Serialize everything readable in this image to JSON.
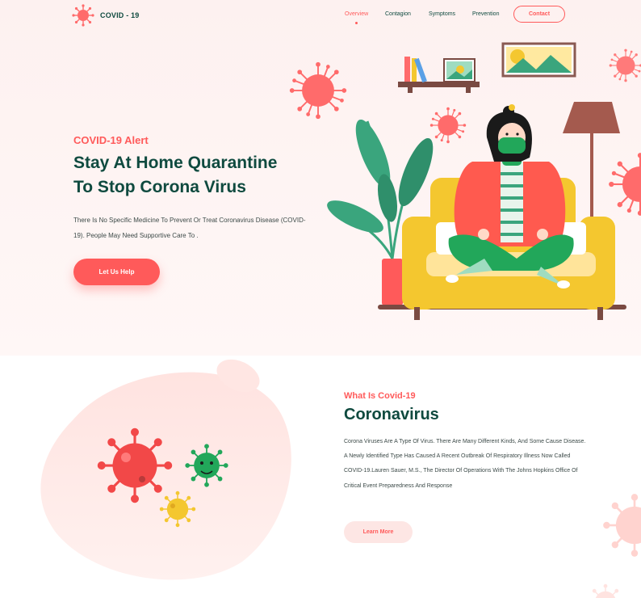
{
  "header": {
    "logo_text": "COVID - 19",
    "nav": [
      "Overview",
      "Contagion",
      "Symptoms",
      "Prevention"
    ],
    "active_nav": "Overview",
    "contact_label": "Contact"
  },
  "hero": {
    "alert": "COVID-19 Alert",
    "headline_line1": "Stay At Home Quarantine",
    "headline_line2": "To Stop Corona Virus",
    "description": "There Is No Specific Medicine To Prevent Or Treat Coronavirus Disease (COVID-19). People May Need Supportive Care To .",
    "cta_label": "Let Us Help"
  },
  "about": {
    "subtitle": "What Is Covid-19",
    "title": "Coronavirus",
    "description": "Corona Viruses Are A Type Of Virus. There Are Many Different Kinds, And Some Cause Disease. A Newly Identified Type Has Caused A Recent Outbreak Of Respiratory Illness Now Called COVID-19.Lauren Sauer, M.S., The Director Of Operations With The Johns Hopkins Office Of Critical Event Preparedness And Response",
    "cta_label": "Learn More"
  },
  "colors": {
    "accent": "#ff5a5a",
    "brand_dark": "#0f4a3f",
    "sofa": "#f4c72f",
    "plant": "#3aa57d"
  },
  "icons": [
    "virus-logo-icon",
    "virus-decoration-icon"
  ]
}
